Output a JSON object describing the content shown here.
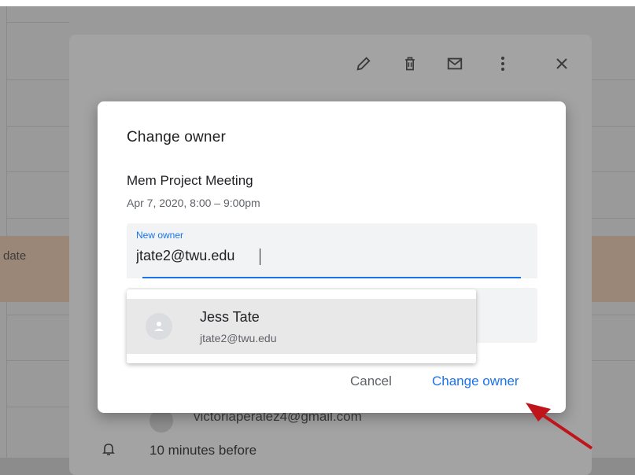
{
  "background": {
    "event_snippet": "date",
    "guest_email": "victoriaperalez4@gmail.com",
    "notification": "10 minutes before"
  },
  "icons": {
    "edit": "pencil-icon",
    "delete": "trash-icon",
    "email": "envelope-icon",
    "more": "more-vert-icon",
    "close": "close-icon",
    "notification": "bell-icon"
  },
  "dialog": {
    "title": "Change owner",
    "event_name": "Mem Project Meeting",
    "event_time": "Apr 7, 2020, 8:00 – 9:00pm",
    "field_label": "New owner",
    "field_value": "jtate2@twu.edu",
    "cancel_label": "Cancel",
    "confirm_label": "Change owner"
  },
  "suggestion": {
    "name": "Jess Tate",
    "email": "jtate2@twu.edu"
  },
  "colors": {
    "accent": "#1a73e8",
    "arrow": "#c0141b"
  }
}
